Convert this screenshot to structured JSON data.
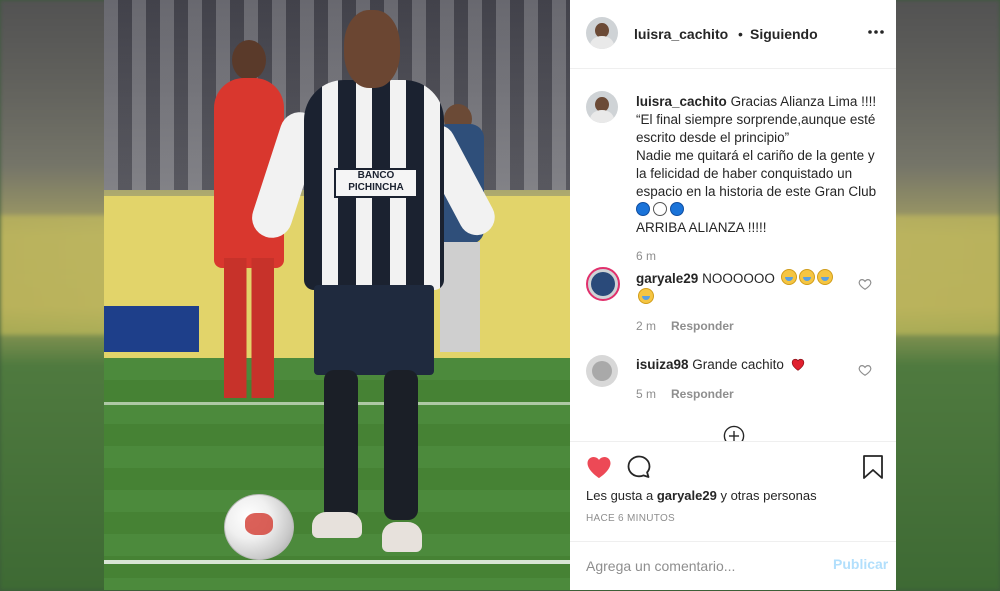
{
  "header": {
    "username": "luisra_cachito",
    "separator": "•",
    "follow_status": "Siguiendo"
  },
  "caption": {
    "username": "luisra_cachito",
    "line1": "Gracias Alianza Lima !!!!",
    "line2": "“El final siempre sorprende,aunque esté escrito desde el principio”",
    "line3": "Nadie me quitará el cariño de la gente y la felicidad de haber conquistado un espacio en la historia de este Gran Club",
    "line4": "ARRIBA ALIANZA !!!!!",
    "time": "6 m",
    "emoji": [
      "blue-circle",
      "white-circle",
      "blue-circle"
    ]
  },
  "comments": [
    {
      "username": "garyale29",
      "text": "NOOOOOO",
      "emoji_count": 4,
      "time": "2 m",
      "reply_label": "Responder"
    },
    {
      "username": "isuiza98",
      "text": "Grande cachito",
      "emoji": "red-heart",
      "time": "5 m",
      "reply_label": "Responder"
    }
  ],
  "likes": {
    "prefix": "Les gusta a",
    "user": "garyale29",
    "suffix": "y otras personas"
  },
  "posted": "HACE 6 MINUTOS",
  "add_comment": {
    "placeholder": "Agrega un comentario...",
    "post_label": "Publicar"
  },
  "photo": {
    "jersey_sponsor": "BANCO PICHINCHA"
  },
  "colors": {
    "like_red": "#ed4956",
    "post_disabled": "#b2dffc",
    "muted": "#8e8e8e",
    "text": "#262626"
  }
}
